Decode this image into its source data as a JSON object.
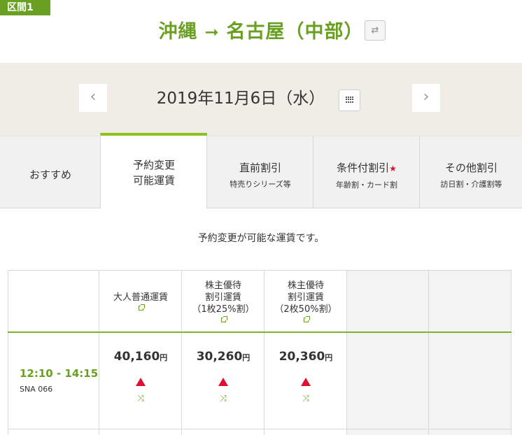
{
  "segment": {
    "label": "区間1"
  },
  "route": {
    "from": "沖縄",
    "arrow": "➞",
    "to": "名古屋（中部）"
  },
  "date": {
    "text": "2019年11月6日（水）",
    "prev_icon": "chevron-left-icon",
    "next_icon": "chevron-right-icon",
    "calendar_icon": "calendar-grid-icon"
  },
  "tabs": [
    {
      "main": "おすすめ",
      "sub": "",
      "active": false
    },
    {
      "main": "予約変更",
      "main2": "可能運賃",
      "sub": "",
      "active": true
    },
    {
      "main": "直前割引",
      "sub": "特売りシリーズ等",
      "active": false
    },
    {
      "main": "条件付割引",
      "star": "★",
      "sub": "年齢割・カード割",
      "active": false
    },
    {
      "main": "その他割引",
      "sub": "訪日割・介護割等",
      "active": false
    }
  ],
  "notice": "予約変更が可能な運賃です。",
  "table": {
    "columns": [
      {
        "line1": "大人普通運賃"
      },
      {
        "line1": "株主優待",
        "line2": "割引運賃",
        "line3": "（1枚25%割）"
      },
      {
        "line1": "株主優待",
        "line2": "割引運賃",
        "line3": "（2枚50%割）"
      }
    ],
    "rows": [
      {
        "time": "12:10 - 14:15",
        "flight": "SNA 066",
        "fares": [
          {
            "price": "40,160",
            "unit": "円"
          },
          {
            "price": "30,260",
            "unit": "円"
          },
          {
            "price": "20,360",
            "unit": "円"
          }
        ]
      }
    ]
  },
  "colors": {
    "brand_green": "#6aa022",
    "tab_accent": "#8bc21e",
    "alert_red": "#e0102e",
    "band_bg": "#efede6"
  }
}
